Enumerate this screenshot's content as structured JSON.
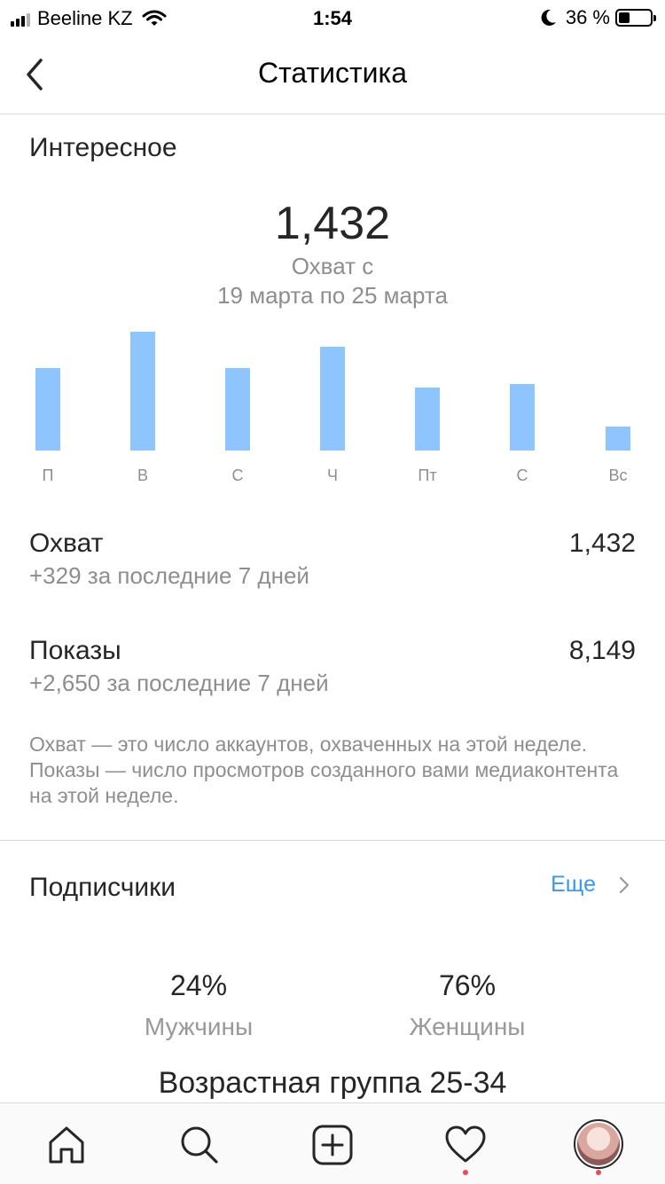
{
  "status_bar": {
    "carrier": "Beeline KZ",
    "time": "1:54",
    "battery_text": "36 %",
    "battery_level": 0.36
  },
  "nav": {
    "title": "Статистика",
    "back_icon": "chevron-left-icon"
  },
  "interesting": {
    "title": "Интересное",
    "reach_total": "1,432",
    "reach_caption": "Охват с",
    "date_range": "19 марта по 25 марта"
  },
  "chart_data": {
    "type": "bar",
    "categories": [
      "П",
      "В",
      "С",
      "Ч",
      "Пт",
      "С",
      "Вс"
    ],
    "values": [
      228,
      330,
      228,
      288,
      174,
      186,
      66
    ],
    "ylim": [
      0,
      340
    ],
    "color": "#8ec5ff",
    "grid": false
  },
  "metrics": {
    "reach": {
      "label": "Охват",
      "value": "1,432",
      "change": "+329 за последние 7 дней"
    },
    "impressions": {
      "label": "Показы",
      "value": "8,149",
      "change": "+2,650 за последние 7 дней"
    },
    "note": "Охват — это число аккаунтов, охваченных на этой неделе. Показы — число просмотров созданного вами медиаконтента на этой неделе."
  },
  "followers": {
    "title": "Подписчики",
    "more_label": "Еще",
    "men_percent": "24%",
    "men_label": "Мужчины",
    "women_percent": "76%",
    "women_label": "Женщины",
    "age_group": "Возрастная группа 25-34"
  },
  "tab_bar": {
    "icons": [
      "home-icon",
      "search-icon",
      "add-post-icon",
      "heart-icon",
      "profile-avatar"
    ],
    "notification_color": "#ed4956"
  },
  "colors": {
    "accent": "#3897f0",
    "text": "#262626",
    "secondary_text": "#8e8e8e",
    "bar": "#8ec5ff"
  }
}
